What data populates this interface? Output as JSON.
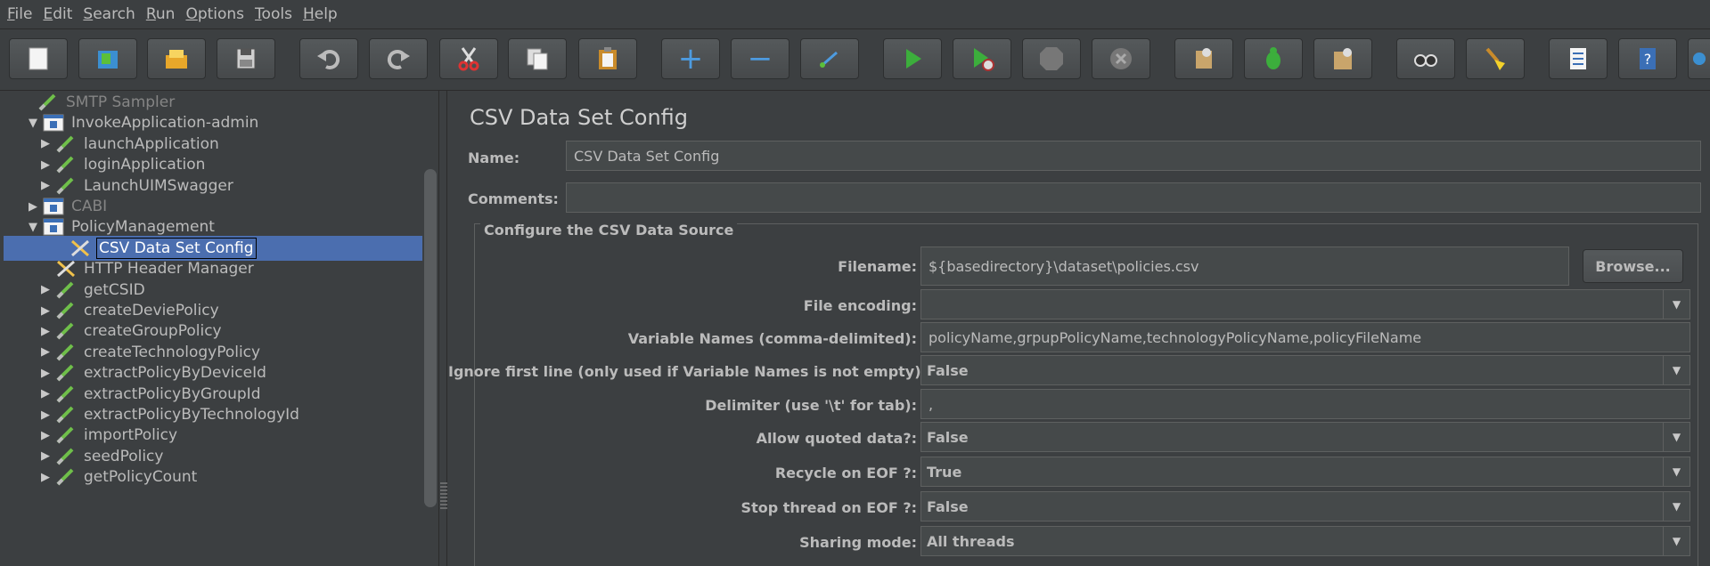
{
  "menu": [
    {
      "label": "File",
      "mnemonic": "F",
      "rest": "ile"
    },
    {
      "label": "Edit",
      "mnemonic": "E",
      "rest": "dit"
    },
    {
      "label": "Search",
      "mnemonic": "S",
      "rest": "earch"
    },
    {
      "label": "Run",
      "mnemonic": "R",
      "rest": "un"
    },
    {
      "label": "Options",
      "mnemonic": "O",
      "rest": "ptions"
    },
    {
      "label": "Tools",
      "mnemonic": "T",
      "rest": "ools"
    },
    {
      "label": "Help",
      "mnemonic": "H",
      "rest": "elp"
    }
  ],
  "toolbar": [
    "new-icon",
    "templates-icon",
    "open-icon",
    "save-icon",
    "undo-icon",
    "redo-icon",
    "cut-icon",
    "copy-icon",
    "paste-icon",
    "expand-icon",
    "collapse-icon",
    "toggle-icon",
    "start-icon",
    "start-no-timers-icon",
    "stop-icon",
    "shutdown-icon",
    "clear-icon",
    "clear-all-icon",
    "remote-icon",
    "search-icon",
    "reset-search-icon",
    "function-helper-icon",
    "help-icon",
    "globe-icon"
  ],
  "tree": {
    "items": [
      {
        "label": "SMTP Sampler",
        "icon": "sampler-icon",
        "disabled": true
      },
      {
        "label": "InvokeApplication-admin",
        "icon": "controller-icon",
        "toggle": "▼"
      },
      {
        "label": "launchApplication",
        "icon": "sampler-icon",
        "toggle": "▶"
      },
      {
        "label": "loginApplication",
        "icon": "sampler-icon",
        "toggle": "▶"
      },
      {
        "label": "LaunchUIMSwagger",
        "icon": "sampler-icon",
        "toggle": "▶"
      },
      {
        "label": "CABI",
        "icon": "controller-icon",
        "toggle": "▶",
        "disabled": true
      },
      {
        "label": "PolicyManagement",
        "icon": "controller-icon",
        "toggle": "▼"
      },
      {
        "label": "CSV Data Set Config",
        "icon": "config-icon",
        "selected": true
      },
      {
        "label": "HTTP Header Manager",
        "icon": "config-icon"
      },
      {
        "label": "getCSID",
        "icon": "sampler-icon",
        "toggle": "▶"
      },
      {
        "label": "createDeviePolicy",
        "icon": "sampler-icon",
        "toggle": "▶"
      },
      {
        "label": "createGroupPolicy",
        "icon": "sampler-icon",
        "toggle": "▶"
      },
      {
        "label": "createTechnologyPolicy",
        "icon": "sampler-icon",
        "toggle": "▶"
      },
      {
        "label": "extractPolicyByDeviceId",
        "icon": "sampler-icon",
        "toggle": "▶"
      },
      {
        "label": "extractPolicyByGroupId",
        "icon": "sampler-icon",
        "toggle": "▶"
      },
      {
        "label": "extractPolicyByTechnologyId",
        "icon": "sampler-icon",
        "toggle": "▶"
      },
      {
        "label": "importPolicy",
        "icon": "sampler-icon",
        "toggle": "▶"
      },
      {
        "label": "seedPolicy",
        "icon": "sampler-icon",
        "toggle": "▶"
      },
      {
        "label": "getPolicyCount",
        "icon": "sampler-icon",
        "toggle": "▶"
      }
    ]
  },
  "panel": {
    "title": "CSV Data Set Config",
    "name_label": "Name:",
    "name_value": "CSV Data Set Config",
    "comments_label": "Comments:",
    "comments_value": "",
    "group_title": "Configure the CSV Data Source",
    "filename_label": "Filename:",
    "filename_value": "${basedirectory}\\dataset\\policies.csv",
    "browse_label": "Browse...",
    "encoding_label": "File encoding:",
    "encoding_value": "",
    "varnames_label": "Variable Names (comma-delimited):",
    "varnames_value": "policyName,grpupPolicyName,technologyPolicyName,policyFileName",
    "ignore_label": "Ignore first line (only used if Variable Names is not empty):",
    "ignore_value": "False",
    "delimiter_label": "Delimiter (use '\\t' for tab):",
    "delimiter_value": ",",
    "quoted_label": "Allow quoted data?:",
    "quoted_value": "False",
    "recycle_label": "Recycle on EOF ?:",
    "recycle_value": "True",
    "stopthread_label": "Stop thread on EOF ?:",
    "stopthread_value": "False",
    "sharing_label": "Sharing mode:",
    "sharing_value": "All threads"
  }
}
